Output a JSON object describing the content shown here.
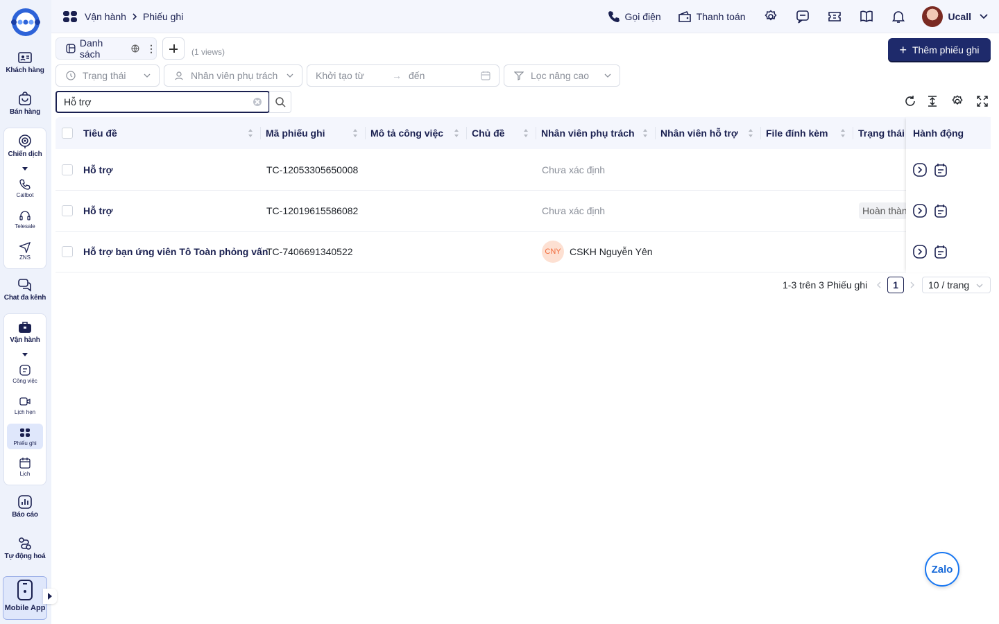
{
  "sidebar": {
    "items": [
      {
        "label": "Khách hàng",
        "icon": "contact-card-icon"
      },
      {
        "label": "Bán hàng",
        "icon": "shopping-bag-icon"
      },
      {
        "label": "Chiến dịch",
        "icon": "target-icon"
      },
      {
        "label": "Chat đa kênh",
        "icon": "chat-bubbles-icon"
      },
      {
        "label": "Vận hành",
        "icon": "briefcase-icon"
      },
      {
        "label": "Báo cáo",
        "icon": "bar-chart-icon"
      },
      {
        "label": "Tự động hoá",
        "icon": "workflow-icon"
      }
    ],
    "campaign_sub": [
      {
        "label": "Callbot",
        "icon": "phone-icon"
      },
      {
        "label": "Telesale",
        "icon": "headset-icon"
      },
      {
        "label": "ZNS",
        "icon": "send-icon"
      }
    ],
    "ops_sub": [
      {
        "label": "Công việc",
        "icon": "task-icon"
      },
      {
        "label": "Lịch hẹn",
        "icon": "video-camera-icon"
      },
      {
        "label": "Phiếu ghi",
        "icon": "ticket-icon"
      },
      {
        "label": "Lịch",
        "icon": "calendar-icon"
      }
    ],
    "mobile_app": "Mobile App"
  },
  "header": {
    "breadcrumb": [
      "Vận hành",
      "Phiếu ghi"
    ],
    "call": "Gọi điện",
    "payment": "Thanh toán",
    "user": "Ucall"
  },
  "toolbar": {
    "view_tab": "Danh sách",
    "views_count": "(1 views)",
    "add_button": "Thêm phiếu ghi"
  },
  "filters": {
    "status": "Trạng thái",
    "assignee": "Nhân viên phụ trách",
    "created_from": "Khởi tạo từ",
    "to": "đến",
    "advanced": "Lọc nâng cao"
  },
  "search": {
    "value": "Hỗ trợ"
  },
  "table": {
    "columns": [
      "Tiêu đề",
      "Mã phiếu ghi",
      "Mô tả công việc",
      "Chủ đề",
      "Nhân viên phụ trách",
      "Nhân viên hỗ trợ",
      "File đính kèm",
      "Trạng thái",
      "Hành động"
    ],
    "rows": [
      {
        "title": "Hỗ trợ",
        "code": "TC-12053305650008",
        "assignee": "Chưa xác định",
        "status": ""
      },
      {
        "title": "Hỗ trợ",
        "code": "TC-12019615586082",
        "assignee": "Chưa xác định",
        "status": "Hoàn thành"
      },
      {
        "title": "Hỗ trợ bạn ứng viên Tô Toàn phỏng vấn",
        "code": "TC-7406691340522",
        "assignee_initials": "CNY",
        "assignee": "CSKH Nguyễn Yên",
        "status": ""
      }
    ]
  },
  "pagination": {
    "summary": "1-3 trên 3 Phiếu ghi",
    "page": "1",
    "page_size": "10 / trang"
  },
  "zalo": "Zalo",
  "colors": {
    "primary": "#1e2a6b",
    "sidebar_bg": "#eef2fb",
    "header_bg": "#f4f6fd"
  }
}
